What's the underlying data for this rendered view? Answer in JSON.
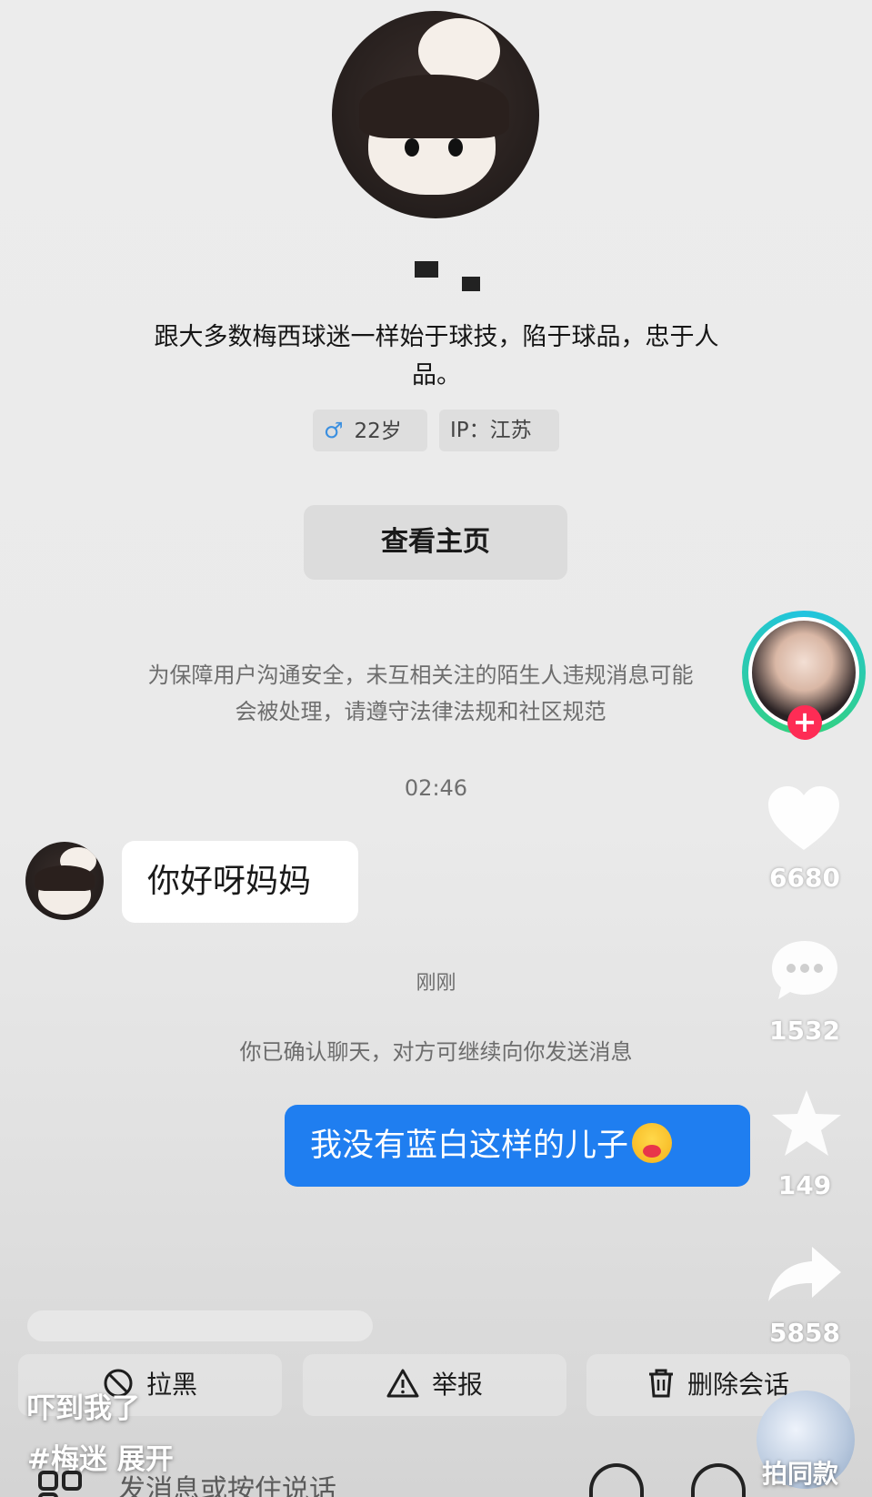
{
  "profile": {
    "bio": "跟大多数梅西球迷一样始于球技，陷于球品，忠于人品。",
    "gender_symbol": "♂",
    "age": "22岁",
    "ip": "IP：江苏",
    "view_home_label": "查看主页"
  },
  "chat": {
    "safety_notice": "为保障用户沟通安全，未互相关注的陌生人违规消息可能\n会被处理，请遵守法律法规和社区规范",
    "timestamp_1": "02:46",
    "incoming_message": "你好呀妈妈",
    "timestamp_2": "刚刚",
    "confirm_notice": "你已确认聊天，对方可继续向你发送消息",
    "outgoing_message": "我没有蓝白这样的儿子"
  },
  "actions": {
    "block_label": "拉黑",
    "report_label": "举报",
    "delete_label": "删除会话"
  },
  "rail": {
    "follow_symbol": "+",
    "likes": "6680",
    "comments": "1532",
    "favorites": "149",
    "shares": "5858"
  },
  "caption": {
    "line1": "吓到我了",
    "line2": "#梅迷  展开"
  },
  "input": {
    "placeholder": "发消息或按住说话"
  },
  "music": {
    "label": "拍同款"
  },
  "colors": {
    "accent_blue": "#1f7ef0",
    "follow_red": "#fe2c55",
    "ring_teal": "#21c4e0"
  }
}
